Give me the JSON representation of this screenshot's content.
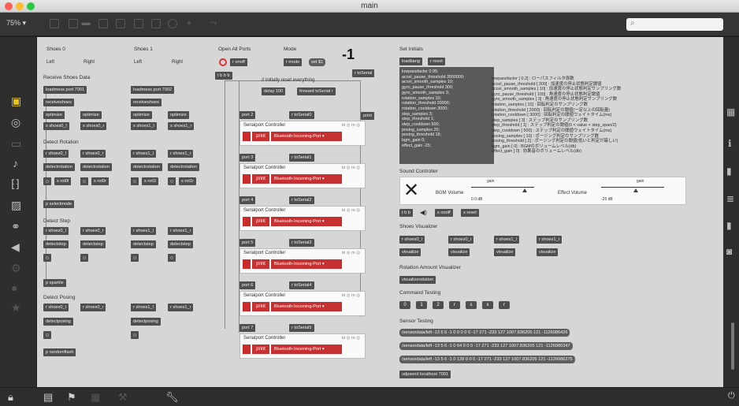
{
  "window": {
    "title": "main",
    "zoom": "75% ▾",
    "light_colors": [
      "#fe5f57",
      "#febc2e",
      "#29c840"
    ]
  },
  "icons": {
    "toolbar": [
      "new-object-icon",
      "message-icon",
      "comment-icon",
      "button-icon",
      "toggle-icon",
      "number-icon",
      "slider-icon",
      "dial-icon",
      "plus-icon",
      "patcher-icon"
    ],
    "search": "search-icon"
  },
  "col1": {
    "shoes0": "Shoes 0",
    "shoes1": "Shoes 1",
    "left": "Left",
    "right": "Right",
    "receive_title": "Receive Shoes Data",
    "loadmess0": "loadmess port 7001",
    "loadmess1": "loadmess port 7002",
    "receiveshoes": "receiveshoes",
    "optimize": "optimize",
    "s_shoes0_l": "s shoes0_l",
    "s_shoes0_r": "s shoes0_r",
    "s_shoes1_l": "s shoes1_l",
    "s_shoes1_r": "s shoes1_r",
    "detect_rotation": "Detect Rotation",
    "r_shoes0_l": "r shoes0_l",
    "r_shoes0_r": "r shoes0_r",
    "r_shoes1_l": "r shoes1_l",
    "r_shoes1_r": "r shoes1_r",
    "detectrotation": "detectrotation",
    "s_rot0l": "s rot0l",
    "s_rot0r": "s rot0r",
    "s_rot1l": "s rot1l",
    "s_rot1r": "s rot1r",
    "p_selectmode": "p selectmode",
    "detect_step": "Detect Step",
    "detectstep": "detectstep",
    "p_sparkle": "p sparkle",
    "detect_posing": "Detect Posing",
    "detectposing": "detectposing",
    "p_randomflash": "p randomflash"
  },
  "col2": {
    "open_all": "Open All Ports",
    "mode": "Mode",
    "r_onoff": "r onoff",
    "r_mode": "r mode",
    "set1": "set $1",
    "neg": "-1",
    "tbbb": "t b b b",
    "reset_comment": "// initially reset everything",
    "delay": "delay 100",
    "forward": "forward toSerial r",
    "r_toserial": "r toSerial",
    "print": "print",
    "ports": [
      {
        "port": "port 2",
        "recv": "r toSerial0"
      },
      {
        "port": "port 3",
        "recv": "r toSerial1"
      },
      {
        "port": "port 4",
        "recv": "r toSerial2"
      },
      {
        "port": "port 5",
        "recv": "r toSerial3"
      },
      {
        "port": "port 6",
        "recv": "r toSerial4"
      },
      {
        "port": "port 7",
        "recv": "r toSerial5"
      }
    ],
    "sp_title": "Serialport Controller",
    "sp_tx": "tx ◎ rx ◎",
    "sp_print": "print",
    "sp_port": "Bluetooth-Incoming-Port  ▾"
  },
  "col3": {
    "set_initials": "Set Initials",
    "loadbang": "loadbang",
    "r_reset": "r reset",
    "params": "lowpassfactor 0.95;\naccel_pause_threshold 3500000;\naccel_smooth_samples 10;\ngyro_pause_threshold 300;\ngyro_smooth_samples 3;\nrotation_samples 10;\nrotation_threshold 20000;\nrotation_cooldown 3000;\nstep_samples 3;\nstep_threshold 1;\nstep_cooldown 500;\nposing_samples 20;\nposing_threshold 18;\nbgm_gain 0;\neffect_gain -25;",
    "descriptions": "lowpassfactor [ 0.2] : ローパスフィルタ係数\naccel_pause_threshold [ 300] : 加速度の停止状態判定閾値\naccel_smooth_samples [ 10] : 加速度の停止状態判定サンプリング数\ngyro_pause_threshold [ 100] : 角速度の停止状態判定閾値\ngyro_smooth_samples [ 3] : 角速度の停止状態判定サンプリング数\nrotation_samples [ 10] : 回転判定のサンプリング数\nrotation_threshold [ 2000] : 回転判定の閾値(一定以上の回転量)\nrotation_cooldown [ 3000] : 回転判定の閾値ウェイトタイム(ms)\nstep_samples [ 3] : ステップ判定のサンプリング数\nstep_threshold [ 1] : ステップ判定の閾値(0 < value < step_span/2)\nstep_cooldown [ 500] : ステップ判定の閾値ウェイトタイム(ms)\nposing_samples [ 10] : ポージング判定のサンプリング数\nposing_threshold [ 2] : ポージング判定の閾値(低いと判定が厳しい)\nbgm_gain [ 0] : BGMのボリュームレベル(db)\neffect_gain [ 0] : 効果音のボリュームレベル(db)",
    "sound_controller": "Sound Controller",
    "bgm_volume": "BGM Volume",
    "effect_volume": "Effect Volume",
    "gain": "gain",
    "bgm_db": "0.0 dB",
    "effect_db": "-25 dB",
    "bgm_level": 0.85,
    "effect_level": 0.55,
    "t_bb": "t b b",
    "s_onoff": "s onoff",
    "s_reset": "s reset",
    "shoes_visualizer": "Shoes Visualizer",
    "visualize": "visualize",
    "rotation_visualizer": "Rotation Amount Visualizer",
    "visualizerotation": "visualizerotation",
    "command_testing": "Command Testing",
    "commands": [
      "0",
      "1",
      "2",
      "r",
      "s",
      "x",
      "r"
    ],
    "sensor_testing": "Sensor Testing",
    "sensors": [
      "/sensordata/left -13 5 6 -1 0 0 0 0 0 -17 271 -233 127 1007.836205 121 -1126086426",
      "/sensordata/left -13 5 6 -1 0 64 0 0 0 -17 271 -233 127 1007.836205 121 -1126086347",
      "/sensordata/left -13 5 6 -1 0 128 0 0 0 -17 271 -233 127 1007.836205 121 -1126086275"
    ],
    "udpsend": "udpsend localhost 7001"
  }
}
